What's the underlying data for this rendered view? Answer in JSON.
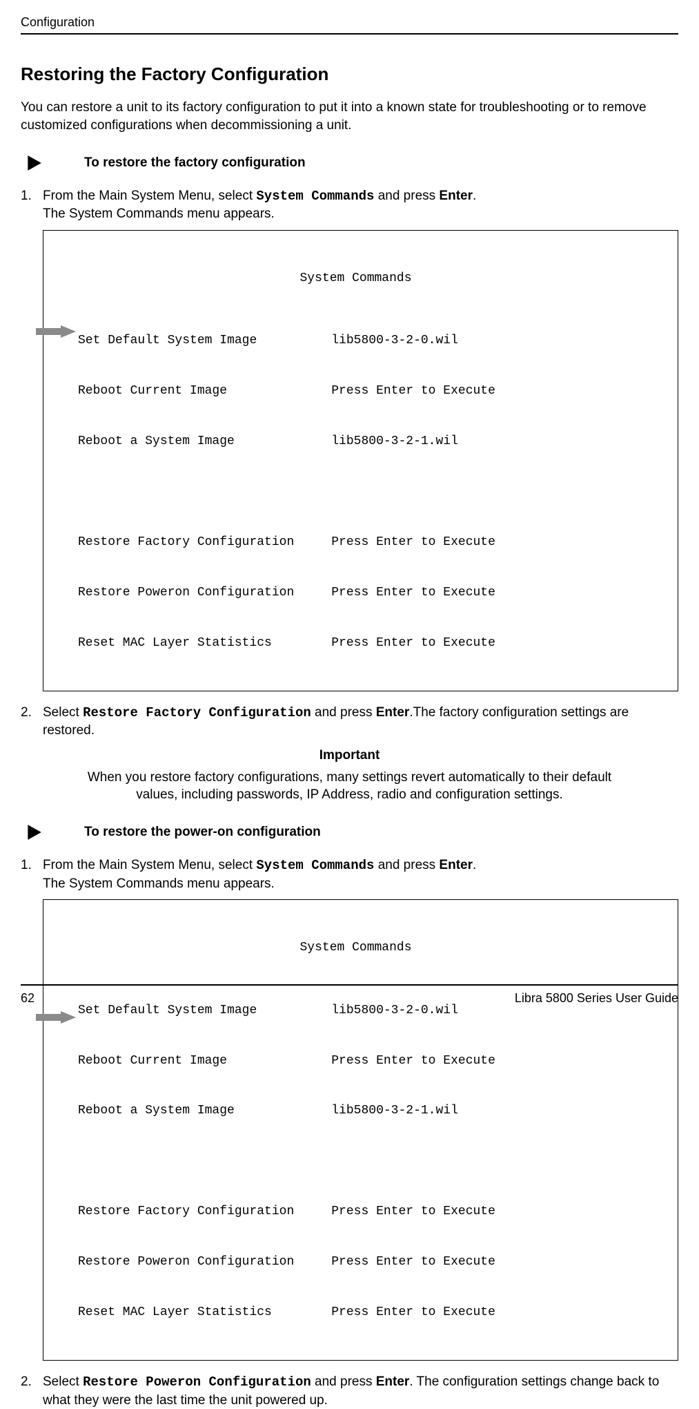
{
  "header": {
    "running": "Configuration"
  },
  "section": {
    "title": "Restoring the Factory Configuration",
    "intro": "You can restore a unit to its factory configuration to put it into a known state for troubleshooting or to remove customized configurations when decommissioning a unit."
  },
  "proc1": {
    "heading": "To restore the factory configuration",
    "step1_num": "1.",
    "step1_a": "From the Main System Menu, select ",
    "step1_cmd": "System Commands",
    "step1_b": " and press ",
    "step1_key": "Enter",
    "step1_c": ".",
    "step1_line2": "The System Commands menu appears.",
    "step2_num": "2.",
    "step2_a": "Select ",
    "step2_cmd": "Restore Factory Configuration",
    "step2_b": " and press ",
    "step2_key": "Enter",
    "step2_c": ".The factory configuration settings are restored."
  },
  "terminal1": {
    "title": "System Commands",
    "r1": "Set Default System Image          lib5800-3-2-0.wil",
    "r2": "Reboot Current Image              Press Enter to Execute",
    "r3": "Reboot a System Image             lib5800-3-2-1.wil",
    "blank": " ",
    "r4": "Restore Factory Configuration     Press Enter to Execute",
    "r5": "Restore Poweron Configuration     Press Enter to Execute",
    "r6": "Reset MAC Layer Statistics        Press Enter to Execute"
  },
  "important": {
    "label": "Important",
    "text": "When you restore factory configurations, many settings revert automatically to their default values, including passwords, IP Address, radio and configuration settings."
  },
  "proc2": {
    "heading": "To restore the power-on configuration",
    "step1_num": "1.",
    "step1_a": "From the Main System Menu, select  ",
    "step1_cmd": "System Commands",
    "step1_b": " and press ",
    "step1_key": "Enter",
    "step1_c": ".",
    "step1_line2": "The System Commands menu appears.",
    "step2_num": "2.",
    "step2_a": "Select ",
    "step2_cmd": "Restore Poweron Configuration",
    "step2_b": " and press ",
    "step2_key": "Enter",
    "step2_c": ". The configuration settings change back to what they were the last time the unit powered up."
  },
  "terminal2": {
    "title": "System Commands",
    "r1": "Set Default System Image          lib5800-3-2-0.wil",
    "r2": "Reboot Current Image              Press Enter to Execute",
    "r3": "Reboot a System Image             lib5800-3-2-1.wil",
    "blank": " ",
    "r4": "Restore Factory Configuration     Press Enter to Execute",
    "r5": "Restore Poweron Configuration     Press Enter to Execute",
    "r6": "Reset MAC Layer Statistics        Press Enter to Execute"
  },
  "footer": {
    "page": "62",
    "doc": "Libra 5800 Series User Guide"
  }
}
